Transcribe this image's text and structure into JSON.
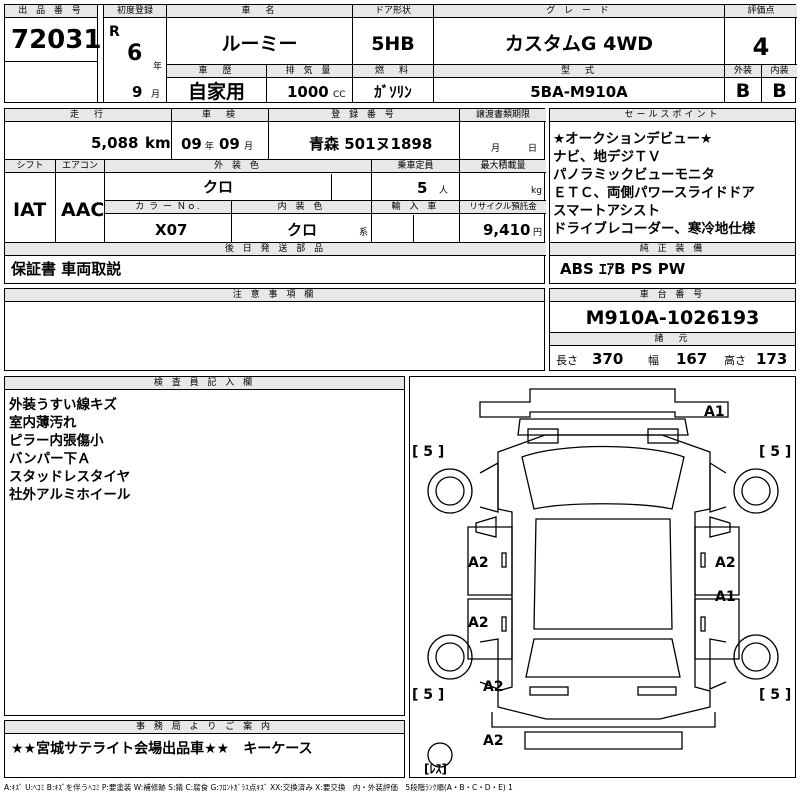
{
  "header": {
    "lot_no_label": "出 品 番 号",
    "lot_no": "72031",
    "first_reg_label": "初度登録",
    "era": "R",
    "year": "6",
    "year_unit": "年",
    "month": "9",
    "month_unit": "月",
    "car_name_label": "車　名",
    "car_name": "ルーミー",
    "door_label": "ドア形状",
    "door": "5HB",
    "grade_label": "グ レ ー ド",
    "grade": "カスタムG 4WD",
    "score_label": "評価点",
    "score": "4",
    "history_label": "車　歴",
    "history": "自家用",
    "displacement_label": "排 気 量",
    "displacement": "1000",
    "displacement_unit": "CC",
    "fuel_label": "燃　料",
    "fuel": "ｶﾞｿﾘﾝ",
    "model_label": "型　式",
    "model": "5BA-M910A",
    "ext_label": "外装",
    "int_label": "内装",
    "ext_score": "B",
    "int_score": "B"
  },
  "mid": {
    "mileage_label": "走　行",
    "mileage": "5,088",
    "mileage_unit": "km",
    "inspection_label": "車　検",
    "insp_year": "09",
    "insp_year_unit": "年",
    "insp_month": "09",
    "insp_month_unit": "月",
    "reg_no_label": "登 録 番 号",
    "reg_no": "青森 501ヌ1898",
    "transfer_label": "譲渡書類期限",
    "transfer_month": "月",
    "transfer_day": "日",
    "shift_label": "シフト",
    "ac_label": "エアコン",
    "shift": "IAT",
    "ac": "AAC",
    "ext_color_label": "外 装 色",
    "ext_color": "クロ",
    "capacity_label": "乗車定員",
    "capacity": "5",
    "capacity_unit": "人",
    "max_load_label": "最大積載量",
    "max_load_unit": "kg",
    "color_no_label": "カ ラ ー Ｎｏ.",
    "color_no": "X07",
    "int_color_label": "内 装 色",
    "int_color": "クロ",
    "int_color_unit": "系",
    "import_label": "輸 入 車",
    "recycle_label": "リサイクル預託金",
    "recycle": "9,410",
    "recycle_unit": "円",
    "later_label": "後 日 発 送 部 品",
    "later": "保証書 車両取説"
  },
  "sales": {
    "label": "セールスポイント",
    "lines": [
      "★オークションデビュー★",
      "ナビ、地デジＴＶ",
      "パノラミックビューモニタ",
      "ＥＴＣ、両側パワースライドドア",
      "スマートアシスト",
      "ドライブレコーダー、寒冷地仕様"
    ],
    "equip_label": "純 正 装 備",
    "equip": "ABS ｴｱB PS PW"
  },
  "notes": {
    "label": "注 意 事 項 欄",
    "text": ""
  },
  "chassis": {
    "label": "車 台 番 号",
    "number": "M910A-1026193",
    "spec_label": "諸　元",
    "length_label": "長さ",
    "length": "370",
    "width_label": "幅",
    "width": "167",
    "height_label": "高さ",
    "height": "173"
  },
  "inspector": {
    "label": "検 査 員 記 入 欄",
    "lines": [
      "外装うすい線キズ",
      "室内薄汚れ",
      "ピラー内張傷小",
      "バンパー下Ａ",
      "スタッドレスタイヤ",
      "社外アルミホイール"
    ]
  },
  "diagram": {
    "marks": [
      "A1",
      "A2",
      "A2",
      "A1",
      "A2",
      "A2",
      "A2"
    ],
    "tire_marks": [
      "[ 5 ]",
      "[ 5 ]",
      "[ 5 ]",
      "[ 5 ]"
    ],
    "spare": "[ﾚｽ]"
  },
  "office": {
    "label": "事 務 局 よ り ご 案 内",
    "text": "★★宮城サテライト会場出品車★★　キーケース"
  },
  "legend": "A:ｷｽﾞ U:ﾍｺﾐ B:ｷｽﾞを伴うﾍｺﾐ P:要塗装 W:補修跡 S:錆 C:腐食 G:ﾌﾛﾝﾄｶﾞﾗｽ点ｷｽﾞ XX:交換済み X:要交換　内・外装評価　5段階ﾗﾝｸ順(A・B・C・D・E) 1"
}
